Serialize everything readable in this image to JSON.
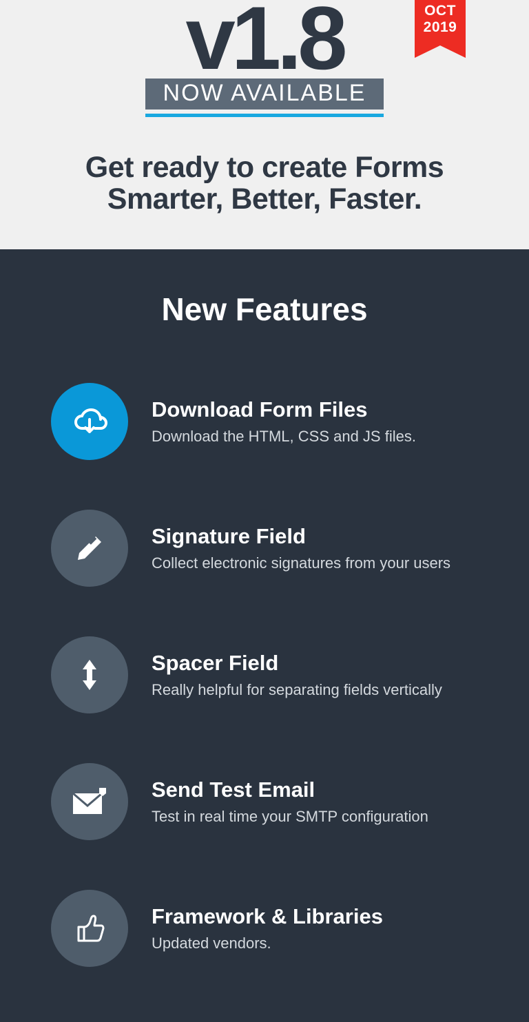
{
  "ribbon": {
    "month": "OCT",
    "year": "2019"
  },
  "hero": {
    "version": "v1.8",
    "badge": "NOW AVAILABLE",
    "tagline_line1": "Get ready to create Forms",
    "tagline_line2": "Smarter, Better, Faster."
  },
  "section_title": "New Features",
  "features": [
    {
      "title": "Download Form Files",
      "desc": "Download the HTML, CSS and JS files."
    },
    {
      "title": "Signature Field",
      "desc": "Collect electronic signatures from your users"
    },
    {
      "title": "Spacer Field",
      "desc": "Really helpful for separating fields vertically"
    },
    {
      "title": "Send Test Email",
      "desc": "Test in real time your SMTP configuration"
    },
    {
      "title": "Framework & Libraries",
      "desc": "Updated vendors."
    }
  ]
}
